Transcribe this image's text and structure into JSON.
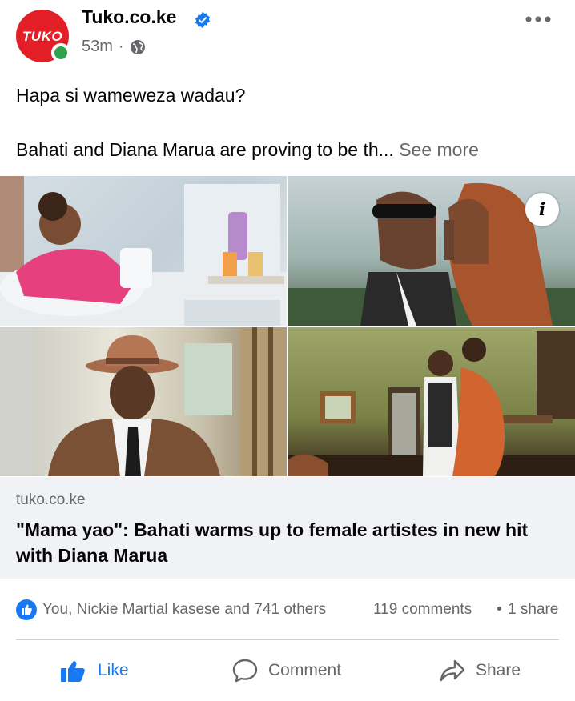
{
  "post": {
    "page_name": "Tuko.co.ke",
    "avatar_text": "TUKO",
    "time": "53m",
    "separator": "·",
    "privacy_icon": "globe-icon",
    "text_line1": "Hapa si wameweza wadau?",
    "text_line2": "Bahati and Diana Marua are proving to be th...",
    "see_more": "See more"
  },
  "link_preview": {
    "domain": "tuko.co.ke",
    "title": "\"Mama yao\": Bahati warms up to female artistes in new hit with Diana Marua",
    "info_label": "i"
  },
  "stats": {
    "reactors": "You, Nickie Martial kasese and 741 others",
    "comments": "119 comments",
    "separator": "•",
    "shares": "1 share"
  },
  "actions": {
    "like": "Like",
    "comment": "Comment",
    "share": "Share"
  },
  "colors": {
    "brand_red": "#e41e26",
    "facebook_blue": "#1877f2",
    "online_green": "#31a24c",
    "secondary_text": "#65676b"
  }
}
